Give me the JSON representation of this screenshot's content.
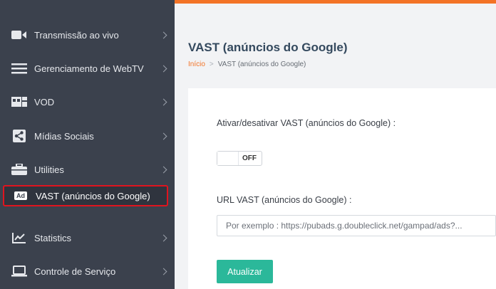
{
  "colors": {
    "accent": "#f37326",
    "sidebar": "#3b414d",
    "highlight": "#e0141e",
    "button": "#2bb89a"
  },
  "sidebar": {
    "items": [
      {
        "label": "Transmissão ao vivo",
        "icon": "video-camera-icon"
      },
      {
        "label": "Gerenciamento de WebTV",
        "icon": "hamburger-menu-icon"
      },
      {
        "label": "VOD",
        "icon": "film-icon"
      },
      {
        "label": "Mídias Sociais",
        "icon": "share-icon"
      },
      {
        "label": "Utilities",
        "icon": "toolbox-icon"
      },
      {
        "label": "VAST (anúncios do Google)",
        "icon": "ad-badge-icon",
        "badge": "Ad",
        "active": true
      },
      {
        "label": "Statistics",
        "icon": "chart-line-icon"
      },
      {
        "label": "Controle de Serviço",
        "icon": "laptop-icon"
      }
    ]
  },
  "header": {
    "title": "VAST (anúncios do Google)"
  },
  "breadcrumb": {
    "home": "Início",
    "current": "VAST (anúncios do Google)"
  },
  "form": {
    "toggle_label": "Ativar/desativar VAST (anúncios do Google) :",
    "toggle_state": "OFF",
    "url_label": "URL VAST (anúncios do Google) :",
    "url_value": "",
    "url_placeholder": "Por exemplo : https://pubads.g.doubleclick.net/gampad/ads?...",
    "submit_label": "Atualizar"
  }
}
